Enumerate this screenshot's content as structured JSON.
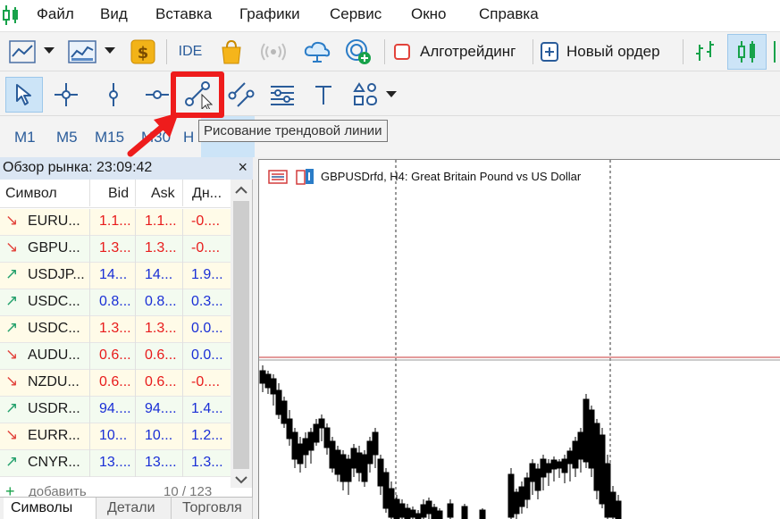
{
  "menu": {
    "items": [
      "Файл",
      "Вид",
      "Вставка",
      "Графики",
      "Сервис",
      "Окно",
      "Справка"
    ]
  },
  "toolbar1": {
    "ide_label": "IDE",
    "algotrading_label": "Алготрейдинг",
    "new_order_label": "Новый ордер",
    "icons": [
      "line-chart-icon",
      "dropdown-arrow-icon",
      "chart-template-icon",
      "dropdown-arrow-icon",
      "dollar-icon",
      "ide-icon",
      "market-bag-icon",
      "signal-radio-icon",
      "cloud-icon",
      "vps-globe-icon",
      "algotrading-icon",
      "new-order-icon",
      "bar-chart-icon",
      "candles-icon"
    ]
  },
  "toolbar2": {
    "tools": [
      "cursor-icon",
      "crosshair-icon",
      "vertical-line-icon",
      "horizontal-line-icon",
      "trendline-icon",
      "channel-icon",
      "fibonacci-icon",
      "text-icon",
      "shapes-icon",
      "dropdown-arrow-icon"
    ]
  },
  "tooltip": {
    "text": "Рисование трендовой линии"
  },
  "timeframes": [
    "M1",
    "M5",
    "M15",
    "M30",
    "H"
  ],
  "market_watch": {
    "title": "Обзор рынка: 23:09:42",
    "columns": [
      "Символ",
      "Bid",
      "Ask",
      "Дн..."
    ],
    "rows": [
      {
        "symbol": "EURU...",
        "bid": "1.1...",
        "ask": "1.1...",
        "change": "-0....",
        "dir": "down",
        "color": "#e81b1b"
      },
      {
        "symbol": "GBPU...",
        "bid": "1.3...",
        "ask": "1.3...",
        "change": "-0....",
        "dir": "down",
        "color": "#e81b1b"
      },
      {
        "symbol": "USDJP...",
        "bid": "14...",
        "ask": "14...",
        "change": "1.9...",
        "dir": "up",
        "color": "#1a2fd6"
      },
      {
        "symbol": "USDC...",
        "bid": "0.8...",
        "ask": "0.8...",
        "change": "0.3...",
        "dir": "up",
        "color": "#1a2fd6"
      },
      {
        "symbol": "USDC...",
        "bid": "1.3...",
        "ask": "1.3...",
        "change": "0.0...",
        "dir": "up",
        "color": "#e81b1b",
        "change_color": "#1a2fd6"
      },
      {
        "symbol": "AUDU...",
        "bid": "0.6...",
        "ask": "0.6...",
        "change": "0.0...",
        "dir": "down",
        "color": "#e81b1b",
        "change_color": "#1a2fd6"
      },
      {
        "symbol": "NZDU...",
        "bid": "0.6...",
        "ask": "0.6...",
        "change": "-0....",
        "dir": "down",
        "color": "#e81b1b"
      },
      {
        "symbol": "USDR...",
        "bid": "94....",
        "ask": "94....",
        "change": "1.4...",
        "dir": "up",
        "color": "#1a2fd6"
      },
      {
        "symbol": "EURR...",
        "bid": "10...",
        "ask": "10...",
        "change": "1.2...",
        "dir": "down",
        "color": "#1a2fd6"
      },
      {
        "symbol": "CNYR...",
        "bid": "13....",
        "ask": "13....",
        "change": "1.3...",
        "dir": "up",
        "color": "#1a2fd6"
      }
    ],
    "add_label": "добавить",
    "count_label": "10 / 123",
    "tabs": [
      "Символы",
      "Детали",
      "Торговля"
    ]
  },
  "chart": {
    "title": "GBPUSDrfd, H4:  Great Britain Pound vs US Dollar"
  },
  "colors": {
    "up_arrow": "#22a06b",
    "down_arrow": "#e2433b",
    "highlight": "#ee1c1c",
    "accent": "#2a5c9a"
  }
}
